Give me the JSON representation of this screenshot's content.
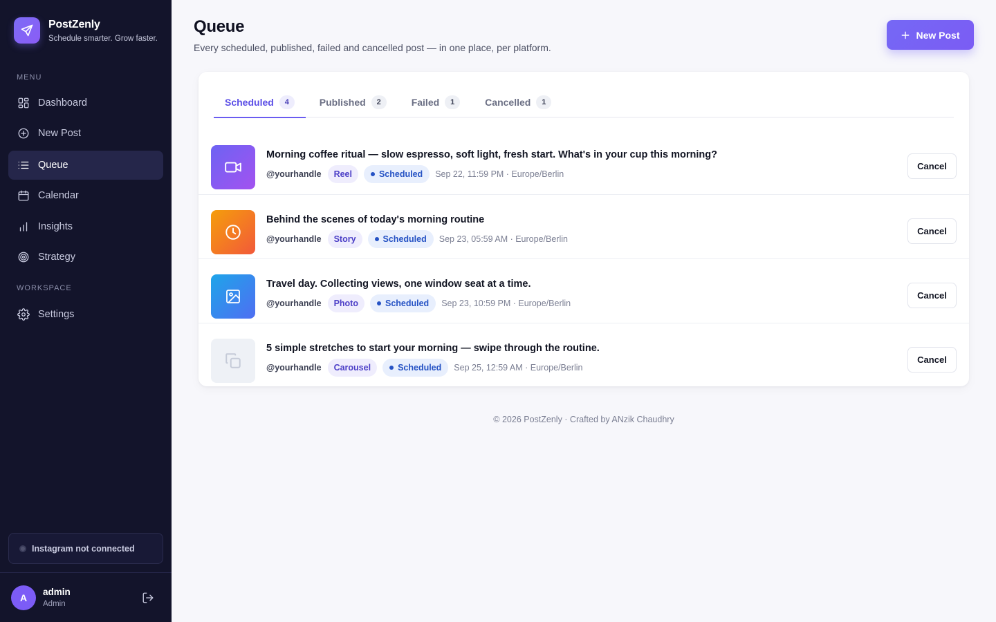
{
  "brand": {
    "name": "PostZenly",
    "tagline": "Schedule smarter. Grow faster."
  },
  "sidebar": {
    "menu_label": "MENU",
    "items": [
      {
        "label": "Dashboard",
        "icon": "dashboard-grid-icon"
      },
      {
        "label": "New Post",
        "icon": "plus-circle-icon"
      },
      {
        "label": "Queue",
        "icon": "list-icon",
        "active": true
      },
      {
        "label": "Calendar",
        "icon": "calendar-icon"
      },
      {
        "label": "Insights",
        "icon": "bar-chart-icon"
      },
      {
        "label": "Strategy",
        "icon": "target-icon"
      }
    ],
    "workspace_label": "WORKSPACE",
    "workspace_items": [
      {
        "label": "Settings",
        "icon": "gear-icon"
      }
    ],
    "instagram_status": "Instagram not connected",
    "user": {
      "initial": "A",
      "name": "admin",
      "role": "Admin"
    }
  },
  "header": {
    "title": "Queue",
    "subtitle": "Every scheduled, published, failed and cancelled post — in one place, per platform.",
    "new_post_label": "New Post"
  },
  "tabs": [
    {
      "label": "Scheduled",
      "count": "4",
      "active": true
    },
    {
      "label": "Published",
      "count": "2"
    },
    {
      "label": "Failed",
      "count": "1"
    },
    {
      "label": "Cancelled",
      "count": "1"
    }
  ],
  "posts": [
    {
      "title": "Morning coffee ritual — slow espresso, soft light, fresh start. What's in your cup this morning?",
      "handle": "@yourhandle",
      "type": "Reel",
      "status": "Scheduled",
      "when": "Sep 22, 11:59 PM · Europe/Berlin",
      "thumb_icon": "video-camera-icon",
      "action": "Cancel"
    },
    {
      "title": "Behind the scenes of today's morning routine",
      "handle": "@yourhandle",
      "type": "Story",
      "status": "Scheduled",
      "when": "Sep 23, 05:59 AM · Europe/Berlin",
      "thumb_icon": "clock-icon",
      "action": "Cancel"
    },
    {
      "title": "Travel day. Collecting views, one window seat at a time.",
      "handle": "@yourhandle",
      "type": "Photo",
      "status": "Scheduled",
      "when": "Sep 23, 10:59 PM · Europe/Berlin",
      "thumb_icon": "image-icon",
      "action": "Cancel"
    },
    {
      "title": "5 simple stretches to start your morning — swipe through the routine.",
      "handle": "@yourhandle",
      "type": "Carousel",
      "status": "Scheduled",
      "when": "Sep 25, 12:59 AM · Europe/Berlin",
      "thumb_icon": "copy-stack-icon",
      "action": "Cancel"
    }
  ],
  "footer": "© 2026 PostZenly · Crafted by ANzik Chaudhry",
  "colors": {
    "accent": "#6a5cf0",
    "sidebar_bg": "#13142b",
    "status_blue": "#2552c4"
  }
}
